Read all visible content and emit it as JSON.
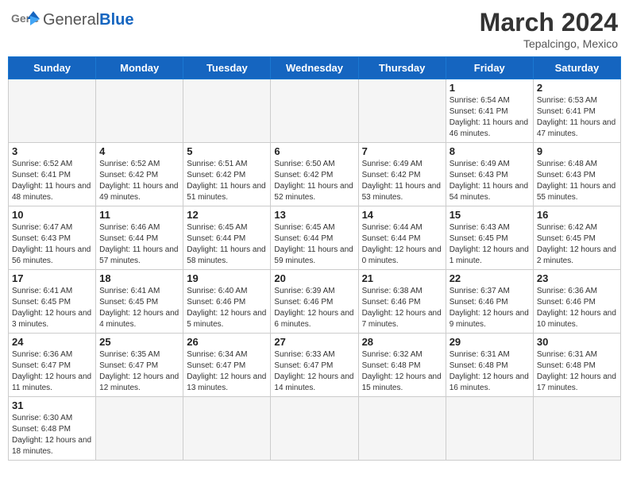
{
  "header": {
    "logo_general": "General",
    "logo_blue": "Blue",
    "month_year": "March 2024",
    "location": "Tepalcingo, Mexico"
  },
  "weekdays": [
    "Sunday",
    "Monday",
    "Tuesday",
    "Wednesday",
    "Thursday",
    "Friday",
    "Saturday"
  ],
  "weeks": [
    [
      {
        "day": "",
        "info": ""
      },
      {
        "day": "",
        "info": ""
      },
      {
        "day": "",
        "info": ""
      },
      {
        "day": "",
        "info": ""
      },
      {
        "day": "",
        "info": ""
      },
      {
        "day": "1",
        "info": "Sunrise: 6:54 AM\nSunset: 6:41 PM\nDaylight: 11 hours and 46 minutes."
      },
      {
        "day": "2",
        "info": "Sunrise: 6:53 AM\nSunset: 6:41 PM\nDaylight: 11 hours and 47 minutes."
      }
    ],
    [
      {
        "day": "3",
        "info": "Sunrise: 6:52 AM\nSunset: 6:41 PM\nDaylight: 11 hours and 48 minutes."
      },
      {
        "day": "4",
        "info": "Sunrise: 6:52 AM\nSunset: 6:42 PM\nDaylight: 11 hours and 49 minutes."
      },
      {
        "day": "5",
        "info": "Sunrise: 6:51 AM\nSunset: 6:42 PM\nDaylight: 11 hours and 51 minutes."
      },
      {
        "day": "6",
        "info": "Sunrise: 6:50 AM\nSunset: 6:42 PM\nDaylight: 11 hours and 52 minutes."
      },
      {
        "day": "7",
        "info": "Sunrise: 6:49 AM\nSunset: 6:42 PM\nDaylight: 11 hours and 53 minutes."
      },
      {
        "day": "8",
        "info": "Sunrise: 6:49 AM\nSunset: 6:43 PM\nDaylight: 11 hours and 54 minutes."
      },
      {
        "day": "9",
        "info": "Sunrise: 6:48 AM\nSunset: 6:43 PM\nDaylight: 11 hours and 55 minutes."
      }
    ],
    [
      {
        "day": "10",
        "info": "Sunrise: 6:47 AM\nSunset: 6:43 PM\nDaylight: 11 hours and 56 minutes."
      },
      {
        "day": "11",
        "info": "Sunrise: 6:46 AM\nSunset: 6:44 PM\nDaylight: 11 hours and 57 minutes."
      },
      {
        "day": "12",
        "info": "Sunrise: 6:45 AM\nSunset: 6:44 PM\nDaylight: 11 hours and 58 minutes."
      },
      {
        "day": "13",
        "info": "Sunrise: 6:45 AM\nSunset: 6:44 PM\nDaylight: 11 hours and 59 minutes."
      },
      {
        "day": "14",
        "info": "Sunrise: 6:44 AM\nSunset: 6:44 PM\nDaylight: 12 hours and 0 minutes."
      },
      {
        "day": "15",
        "info": "Sunrise: 6:43 AM\nSunset: 6:45 PM\nDaylight: 12 hours and 1 minute."
      },
      {
        "day": "16",
        "info": "Sunrise: 6:42 AM\nSunset: 6:45 PM\nDaylight: 12 hours and 2 minutes."
      }
    ],
    [
      {
        "day": "17",
        "info": "Sunrise: 6:41 AM\nSunset: 6:45 PM\nDaylight: 12 hours and 3 minutes."
      },
      {
        "day": "18",
        "info": "Sunrise: 6:41 AM\nSunset: 6:45 PM\nDaylight: 12 hours and 4 minutes."
      },
      {
        "day": "19",
        "info": "Sunrise: 6:40 AM\nSunset: 6:46 PM\nDaylight: 12 hours and 5 minutes."
      },
      {
        "day": "20",
        "info": "Sunrise: 6:39 AM\nSunset: 6:46 PM\nDaylight: 12 hours and 6 minutes."
      },
      {
        "day": "21",
        "info": "Sunrise: 6:38 AM\nSunset: 6:46 PM\nDaylight: 12 hours and 7 minutes."
      },
      {
        "day": "22",
        "info": "Sunrise: 6:37 AM\nSunset: 6:46 PM\nDaylight: 12 hours and 9 minutes."
      },
      {
        "day": "23",
        "info": "Sunrise: 6:36 AM\nSunset: 6:46 PM\nDaylight: 12 hours and 10 minutes."
      }
    ],
    [
      {
        "day": "24",
        "info": "Sunrise: 6:36 AM\nSunset: 6:47 PM\nDaylight: 12 hours and 11 minutes."
      },
      {
        "day": "25",
        "info": "Sunrise: 6:35 AM\nSunset: 6:47 PM\nDaylight: 12 hours and 12 minutes."
      },
      {
        "day": "26",
        "info": "Sunrise: 6:34 AM\nSunset: 6:47 PM\nDaylight: 12 hours and 13 minutes."
      },
      {
        "day": "27",
        "info": "Sunrise: 6:33 AM\nSunset: 6:47 PM\nDaylight: 12 hours and 14 minutes."
      },
      {
        "day": "28",
        "info": "Sunrise: 6:32 AM\nSunset: 6:48 PM\nDaylight: 12 hours and 15 minutes."
      },
      {
        "day": "29",
        "info": "Sunrise: 6:31 AM\nSunset: 6:48 PM\nDaylight: 12 hours and 16 minutes."
      },
      {
        "day": "30",
        "info": "Sunrise: 6:31 AM\nSunset: 6:48 PM\nDaylight: 12 hours and 17 minutes."
      }
    ],
    [
      {
        "day": "31",
        "info": "Sunrise: 6:30 AM\nSunset: 6:48 PM\nDaylight: 12 hours and 18 minutes."
      },
      {
        "day": "",
        "info": ""
      },
      {
        "day": "",
        "info": ""
      },
      {
        "day": "",
        "info": ""
      },
      {
        "day": "",
        "info": ""
      },
      {
        "day": "",
        "info": ""
      },
      {
        "day": "",
        "info": ""
      }
    ]
  ]
}
